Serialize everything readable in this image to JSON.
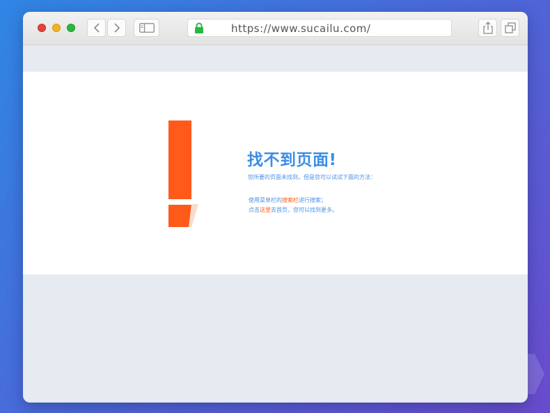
{
  "browser": {
    "url": "https://www.sucailu.com/",
    "icons": [
      "close-icon",
      "minimize-icon",
      "zoom-icon",
      "chevron-left-icon",
      "chevron-right-icon",
      "sidebar-icon",
      "lock-icon",
      "share-icon",
      "tabs-icon"
    ]
  },
  "error": {
    "title": "找不到页面!",
    "subtitle": "您所要的页面未找到，但是您可以试试下面的方法：",
    "line1": {
      "prefix": "使用菜单栏的",
      "highlight": "搜索栏",
      "suffix": "进行搜索；"
    },
    "line2": {
      "prefix": "点击",
      "highlight": "这里",
      "suffix": "去首页，您可以找到更多。"
    }
  },
  "colors": {
    "accent": "#ff5a1a",
    "title": "#3b8ee3",
    "text": "#4a90e2"
  }
}
